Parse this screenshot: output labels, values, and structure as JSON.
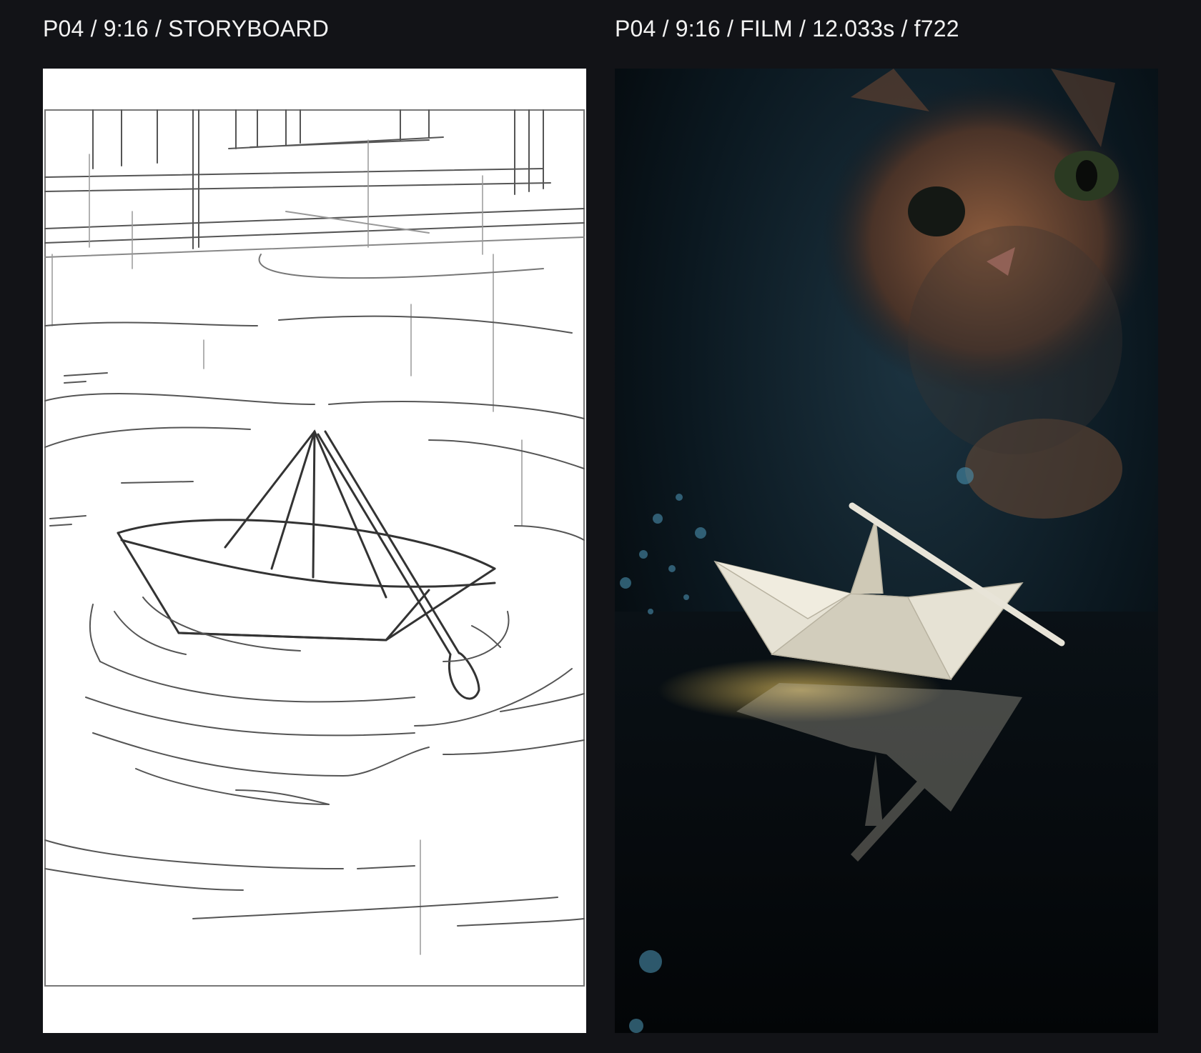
{
  "panels": {
    "left": {
      "label": "P04 / 9:16 / STORYBOARD"
    },
    "right": {
      "label": "P04 / 9:16 / FILM / 12.033s / f722"
    }
  },
  "colors": {
    "page_background": "#121317",
    "label_text": "#f2f2f2",
    "sketch_line": "#444444",
    "film_background": "#05090d",
    "boat_glow": "#ffd766"
  }
}
